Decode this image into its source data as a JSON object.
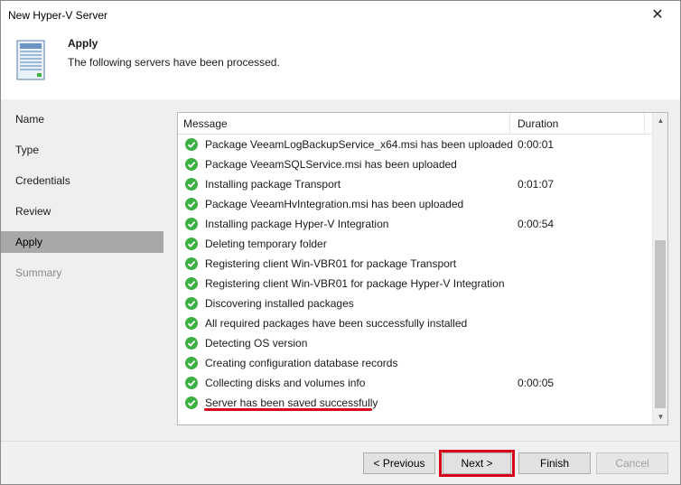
{
  "window": {
    "title": "New Hyper-V Server",
    "close_glyph": "✕"
  },
  "header": {
    "icon": "server-document-icon",
    "title": "Apply",
    "subtitle": "The following servers have been processed."
  },
  "sidebar": {
    "items": [
      {
        "label": "Name",
        "state": "normal"
      },
      {
        "label": "Type",
        "state": "normal"
      },
      {
        "label": "Credentials",
        "state": "normal"
      },
      {
        "label": "Review",
        "state": "normal"
      },
      {
        "label": "Apply",
        "state": "active"
      },
      {
        "label": "Summary",
        "state": "disabled"
      }
    ]
  },
  "log": {
    "columns": {
      "message": "Message",
      "duration": "Duration"
    },
    "rows": [
      {
        "message": "Package VeeamLogBackupService_x64.msi has been uploaded",
        "duration": "0:00:01"
      },
      {
        "message": "Package VeeamSQLService.msi has been uploaded",
        "duration": ""
      },
      {
        "message": "Installing package Transport",
        "duration": "0:01:07"
      },
      {
        "message": "Package VeeamHvIntegration.msi has been uploaded",
        "duration": ""
      },
      {
        "message": "Installing package Hyper-V Integration",
        "duration": "0:00:54"
      },
      {
        "message": "Deleting temporary folder",
        "duration": ""
      },
      {
        "message": "Registering client Win-VBR01 for package Transport",
        "duration": ""
      },
      {
        "message": "Registering client Win-VBR01 for package Hyper-V Integration",
        "duration": ""
      },
      {
        "message": "Discovering installed packages",
        "duration": ""
      },
      {
        "message": "All required packages have been successfully installed",
        "duration": ""
      },
      {
        "message": "Detecting OS version",
        "duration": ""
      },
      {
        "message": "Creating configuration database records",
        "duration": ""
      },
      {
        "message": "Collecting disks and volumes info",
        "duration": "0:00:05"
      },
      {
        "message": "Server has been saved successfully",
        "duration": ""
      }
    ],
    "status_icon": "success-check-icon",
    "status_color": "#3cb043"
  },
  "buttons": {
    "previous": "< Previous",
    "next": "Next >",
    "finish": "Finish",
    "cancel": "Cancel"
  },
  "colors": {
    "highlight": "#d9001b",
    "active_nav": "#a8a8a8"
  }
}
